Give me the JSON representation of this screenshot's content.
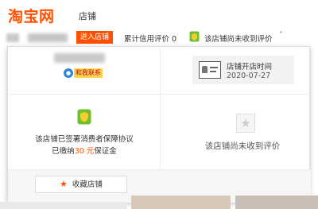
{
  "header": {
    "logo_text": "淘宝网",
    "store_label": "店铺"
  },
  "topbar": {
    "enter_store": "进入店铺",
    "credit_rating": "累计信用评价 0",
    "no_evaluation": "该店铺尚未收到评价",
    "caret": "˄",
    "icons": [
      "consumer-guarantee-icon",
      "chevron-up-icon"
    ]
  },
  "panel": {
    "contact_label": "和我联系",
    "open_time_title": "店铺开店时间",
    "open_date": "2020-07-27",
    "agreement_text": "该店铺已签署消费者保障协议",
    "deposit_prefix": "已缴纳",
    "deposit_amount": "30 元",
    "deposit_suffix": "保证金",
    "no_evaluation": "该店铺尚未收到评价",
    "favorite_label": "收藏店铺",
    "icons": [
      "id-card-icon",
      "guarantee-shield-icon",
      "star-icon",
      "chat-icon"
    ]
  },
  "colors": {
    "brand_orange": "#ff5000",
    "guarantee_green": "#6fbf2e",
    "contact_yellow": "#ffd34e"
  }
}
